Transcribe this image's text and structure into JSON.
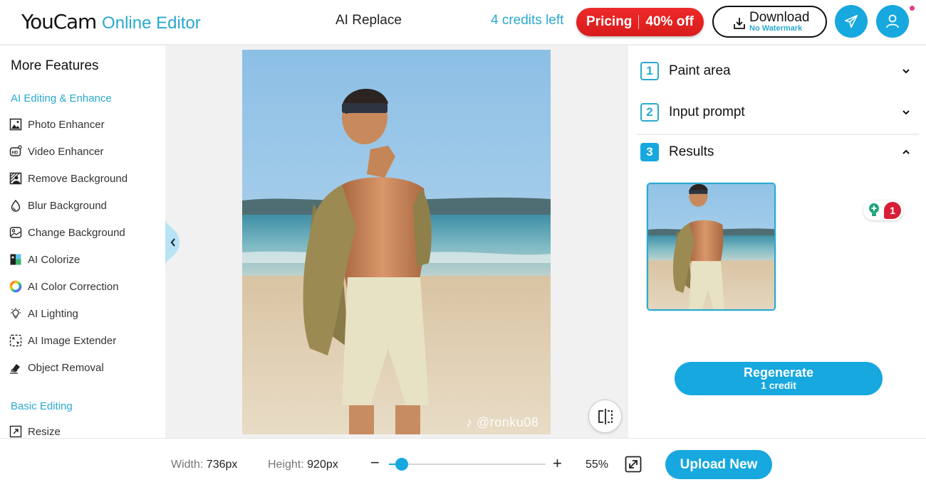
{
  "header": {
    "logo_main": "YouCam",
    "logo_sub": "Online Editor",
    "page_title": "AI Replace",
    "credits_left": "4 credits left",
    "pricing_label": "Pricing",
    "pricing_discount": "40% off",
    "download_label": "Download",
    "download_sublabel": "No Watermark",
    "icons": {
      "send": "paper-plane-icon",
      "user": "user-icon",
      "download": "download-icon"
    },
    "notification_dot_color": "#e33d8a"
  },
  "sidebar": {
    "title": "More Features",
    "sections": [
      {
        "label": "AI Editing & Enhance",
        "items": [
          {
            "label": "Photo Enhancer",
            "icon": "photo-enhancer-icon"
          },
          {
            "label": "Video Enhancer",
            "icon": "video-enhancer-icon"
          },
          {
            "label": "Remove Background",
            "icon": "remove-background-icon"
          },
          {
            "label": "Blur Background",
            "icon": "droplet-icon"
          },
          {
            "label": "Change Background",
            "icon": "change-background-icon"
          },
          {
            "label": "AI Colorize",
            "icon": "colorize-icon"
          },
          {
            "label": "AI Color Correction",
            "icon": "color-wheel-icon"
          },
          {
            "label": "AI Lighting",
            "icon": "lightbulb-icon"
          },
          {
            "label": "AI Image Extender",
            "icon": "image-extender-icon"
          },
          {
            "label": "Object Removal",
            "icon": "eraser-icon"
          }
        ]
      },
      {
        "label": "Basic Editing",
        "items": [
          {
            "label": "Resize",
            "icon": "resize-icon"
          }
        ]
      }
    ]
  },
  "canvas": {
    "watermark": "@ronku08",
    "image_alt": "Man in sunglasses and open patterned shirt on a beach"
  },
  "panel": {
    "steps": [
      {
        "number": "1",
        "label": "Paint area",
        "expanded": false
      },
      {
        "number": "2",
        "label": "Input prompt",
        "expanded": false
      },
      {
        "number": "3",
        "label": "Results",
        "expanded": true
      }
    ],
    "hint_count": "1",
    "regenerate_label": "Regenerate",
    "regenerate_cost": "1 credit"
  },
  "footer": {
    "width_label": "Width:",
    "width_value": "736px",
    "height_label": "Height:",
    "height_value": "920px",
    "zoom_minus": "−",
    "zoom_plus": "+",
    "zoom_percent": "55%",
    "zoom_slider_fraction": 0.08,
    "upload_label": "Upload New"
  },
  "colors": {
    "accent": "#16a8df",
    "accent_text": "#2aa9cf",
    "pricing_red": "#d81b1b",
    "badge_red": "#d81e36"
  }
}
